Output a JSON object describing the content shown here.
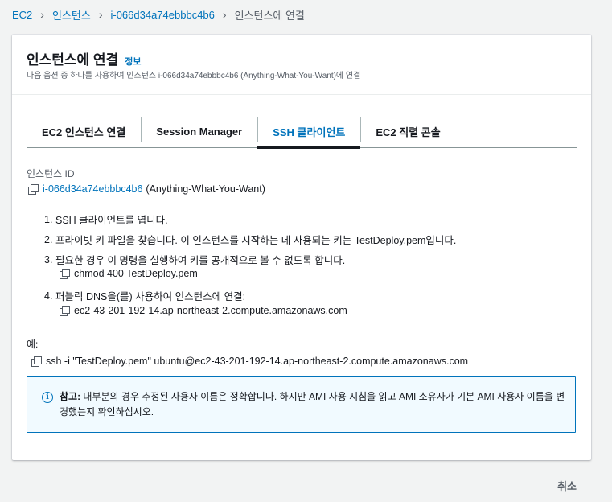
{
  "breadcrumb": {
    "items": [
      "EC2",
      "인스턴스",
      "i-066d34a74ebbbc4b6"
    ],
    "current": "인스턴스에 연결"
  },
  "header": {
    "title": "인스턴스에 연결",
    "info": "정보",
    "description": "다음 옵션 중 하나를 사용하여 인스턴스 i-066d34a74ebbbc4b6 (Anything-What-You-Want)에 연결"
  },
  "tabs": [
    {
      "label": "EC2 인스턴스 연결",
      "active": false
    },
    {
      "label": "Session Manager",
      "active": false
    },
    {
      "label": "SSH 클라이언트",
      "active": true
    },
    {
      "label": "EC2 직렬 콘솔",
      "active": false
    }
  ],
  "instance": {
    "label": "인스턴스 ID",
    "id": "i-066d34a74ebbbc4b6",
    "name": "(Anything-What-You-Want)"
  },
  "steps": [
    {
      "num": "1.",
      "text": "SSH 클라이언트를 엽니다."
    },
    {
      "num": "2.",
      "text": "프라이빗 키 파일을 찾습니다. 이 인스턴스를 시작하는 데 사용되는 키는 TestDeploy.pem입니다."
    },
    {
      "num": "3.",
      "text": "필요한 경우 이 명령을 실행하여 키를 공개적으로 볼 수 없도록 합니다.",
      "command": "chmod 400 TestDeploy.pem"
    },
    {
      "num": "4.",
      "text": "퍼블릭 DNS을(를) 사용하여 인스턴스에 연결:",
      "command": "ec2-43-201-192-14.ap-northeast-2.compute.amazonaws.com"
    }
  ],
  "example": {
    "label": "예:",
    "command": "ssh -i \"TestDeploy.pem\" ubuntu@ec2-43-201-192-14.ap-northeast-2.compute.amazonaws.com"
  },
  "alert": {
    "icon": "info-icon",
    "label": "참고:",
    "text": " 대부분의 경우 추정된 사용자 이름은 정확합니다. 하지만 AMI 사용 지침을 읽고 AMI 소유자가 기본 AMI 사용자 이름을 변경했는지 확인하십시오."
  },
  "footer": {
    "cancel": "취소"
  },
  "colors": {
    "link": "#0073bb",
    "background": "#f2f3f3",
    "alert_bg": "#f1faff"
  }
}
